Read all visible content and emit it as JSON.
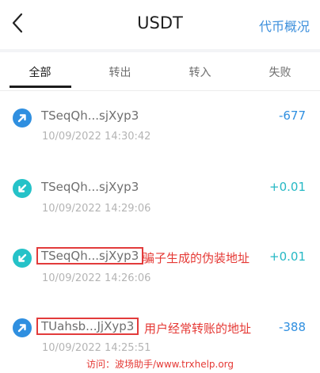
{
  "header": {
    "title": "USDT",
    "overview_label": "代币概况"
  },
  "tabs": [
    {
      "label": "全部"
    },
    {
      "label": "转出"
    },
    {
      "label": "转入"
    },
    {
      "label": "失败"
    }
  ],
  "transactions": [
    {
      "direction": "out",
      "address": "TSeqQh...sjXyp3",
      "time": "10/09/2022 14:30:42",
      "amount": "-677"
    },
    {
      "direction": "in",
      "address": "TSeqQh...sjXyp3",
      "time": "10/09/2022 14:29:06",
      "amount": "+0.01"
    },
    {
      "direction": "in",
      "address": "TSeqQh...sjXyp3",
      "time": "10/09/2022 14:26:06",
      "amount": "+0.01"
    },
    {
      "direction": "out",
      "address": "TUahsb...JjXyp3",
      "time": "10/09/2022 14:25:51",
      "amount": "-388"
    }
  ],
  "annotations": {
    "fake_address_note": "骗子生成的伪装地址",
    "real_address_note": "用户经常转账的地址",
    "footer": "访问：波场助手/www.trxhelp.org"
  },
  "colors": {
    "out_icon": "#2f8fe0",
    "in_icon": "#25c2c8",
    "highlight_box": "#e23b3b",
    "annotation_text": "#e53935",
    "accent": "#3c8fdc"
  }
}
